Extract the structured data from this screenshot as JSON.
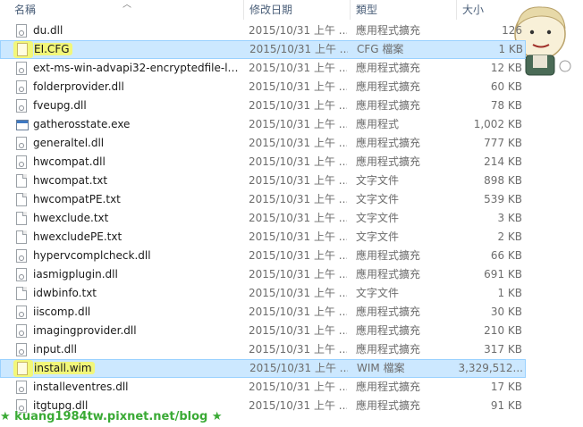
{
  "header": {
    "name": "名稱",
    "date": "修改日期",
    "type": "類型",
    "size": "大小"
  },
  "files": [
    {
      "name": "du.dll",
      "date": "2015/10/31 上午 ...",
      "type": "應用程式擴充",
      "size": "126",
      "icon": "dll",
      "selected": false,
      "highlight": false
    },
    {
      "name": "EI.CFG",
      "date": "2015/10/31 上午 ...",
      "type": "CFG 檔案",
      "size": "1 KB",
      "icon": "yellow-doc",
      "selected": true,
      "highlight": true
    },
    {
      "name": "ext-ms-win-advapi32-encryptedfile-l1...",
      "date": "2015/10/31 上午 ...",
      "type": "應用程式擴充",
      "size": "12 KB",
      "icon": "dll",
      "selected": false,
      "highlight": false
    },
    {
      "name": "folderprovider.dll",
      "date": "2015/10/31 上午 ...",
      "type": "應用程式擴充",
      "size": "60 KB",
      "icon": "dll",
      "selected": false,
      "highlight": false
    },
    {
      "name": "fveupg.dll",
      "date": "2015/10/31 上午 ...",
      "type": "應用程式擴充",
      "size": "78 KB",
      "icon": "dll",
      "selected": false,
      "highlight": false
    },
    {
      "name": "gatherosstate.exe",
      "date": "2015/10/31 上午 ...",
      "type": "應用程式",
      "size": "1,002 KB",
      "icon": "exe",
      "selected": false,
      "highlight": false
    },
    {
      "name": "generaltel.dll",
      "date": "2015/10/31 上午 ...",
      "type": "應用程式擴充",
      "size": "777 KB",
      "icon": "dll",
      "selected": false,
      "highlight": false
    },
    {
      "name": "hwcompat.dll",
      "date": "2015/10/31 上午 ...",
      "type": "應用程式擴充",
      "size": "214 KB",
      "icon": "dll",
      "selected": false,
      "highlight": false
    },
    {
      "name": "hwcompat.txt",
      "date": "2015/10/31 上午 ...",
      "type": "文字文件",
      "size": "898 KB",
      "icon": "txt",
      "selected": false,
      "highlight": false
    },
    {
      "name": "hwcompatPE.txt",
      "date": "2015/10/31 上午 ...",
      "type": "文字文件",
      "size": "539 KB",
      "icon": "txt",
      "selected": false,
      "highlight": false
    },
    {
      "name": "hwexclude.txt",
      "date": "2015/10/31 上午 ...",
      "type": "文字文件",
      "size": "3 KB",
      "icon": "txt",
      "selected": false,
      "highlight": false
    },
    {
      "name": "hwexcludePE.txt",
      "date": "2015/10/31 上午 ...",
      "type": "文字文件",
      "size": "2 KB",
      "icon": "txt",
      "selected": false,
      "highlight": false
    },
    {
      "name": "hypervcomplcheck.dll",
      "date": "2015/10/31 上午 ...",
      "type": "應用程式擴充",
      "size": "66 KB",
      "icon": "dll",
      "selected": false,
      "highlight": false
    },
    {
      "name": "iasmigplugin.dll",
      "date": "2015/10/31 上午 ...",
      "type": "應用程式擴充",
      "size": "691 KB",
      "icon": "dll",
      "selected": false,
      "highlight": false
    },
    {
      "name": "idwbinfo.txt",
      "date": "2015/10/31 上午 ...",
      "type": "文字文件",
      "size": "1 KB",
      "icon": "txt",
      "selected": false,
      "highlight": false
    },
    {
      "name": "iiscomp.dll",
      "date": "2015/10/31 上午 ...",
      "type": "應用程式擴充",
      "size": "30 KB",
      "icon": "dll",
      "selected": false,
      "highlight": false
    },
    {
      "name": "imagingprovider.dll",
      "date": "2015/10/31 上午 ...",
      "type": "應用程式擴充",
      "size": "210 KB",
      "icon": "dll",
      "selected": false,
      "highlight": false
    },
    {
      "name": "input.dll",
      "date": "2015/10/31 上午 ...",
      "type": "應用程式擴充",
      "size": "317 KB",
      "icon": "dll",
      "selected": false,
      "highlight": false
    },
    {
      "name": "install.wim",
      "date": "2015/10/31 上午 ...",
      "type": "WIM 檔案",
      "size": "3,329,512...",
      "icon": "yellow-doc",
      "selected": true,
      "highlight": true
    },
    {
      "name": "installeventres.dll",
      "date": "2015/10/31 上午 ...",
      "type": "應用程式擴充",
      "size": "17 KB",
      "icon": "dll",
      "selected": false,
      "highlight": false
    },
    {
      "name": "itgtupg.dll",
      "date": "2015/10/31 上午 ...",
      "type": "應用程式擴充",
      "size": "91 KB",
      "icon": "dll",
      "selected": false,
      "highlight": false
    }
  ],
  "watermark": "★ kuang1984tw.pixnet.net/blog ★",
  "colors": {
    "selection": "#cce8ff",
    "selection_border": "#99d1ff",
    "highlight": "#f2f77a",
    "header_text": "#4c607a",
    "watermark": "#3aaa35"
  }
}
